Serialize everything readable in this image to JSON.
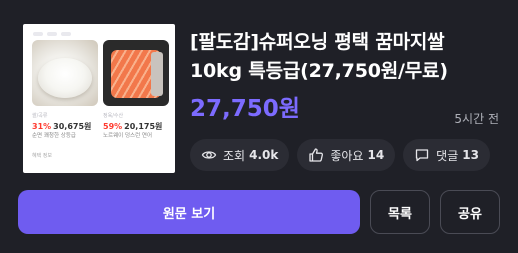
{
  "deal": {
    "title_line1": "[팔도감]슈퍼오닝 평택 꿈마지쌀",
    "title_line2": "10kg 특등급(27,750원/무료)",
    "price": "27,750원",
    "posted_ago": "5시간 전"
  },
  "thumbnail": {
    "products": [
      {
        "type_label": "쌀/곡류",
        "discount": "31%",
        "price": "30,675원",
        "desc": "순면 쾌청한 상등급"
      },
      {
        "type_label": "정육/수산",
        "discount": "59%",
        "price": "20,175원",
        "desc": "노르웨이 덩스런 연어"
      }
    ],
    "footer": "혜택 정보"
  },
  "stats": {
    "views_label": "조회",
    "views_value": "4.0k",
    "likes_label": "좋아요",
    "likes_value": "14",
    "comments_label": "댓글",
    "comments_value": "13"
  },
  "actions": {
    "view_original": "원문 보기",
    "list": "목록",
    "share": "공유"
  },
  "colors": {
    "accent": "#6f5cf0",
    "price": "#7c6bff",
    "background": "#1f2027",
    "discount": "#ff3b30"
  }
}
